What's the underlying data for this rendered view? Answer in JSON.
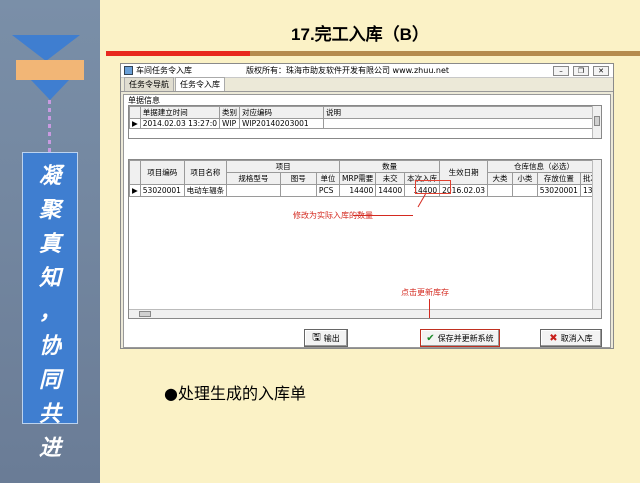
{
  "slide": {
    "title": "17.完工入库（B）",
    "motto_chars": [
      "凝",
      "聚",
      "真",
      "知",
      "，",
      "协",
      "同",
      "共",
      "进"
    ],
    "bullet": "●处理生成的入库单"
  },
  "window": {
    "title": "车间任务令入库",
    "copyright": "版权所有：珠海市助友软件开发有限公司 www.zhuu.net",
    "tabs": [
      "任务令导航",
      "任务令入库"
    ],
    "section_label": "单据信息",
    "header_grid": {
      "columns": [
        "单据建立时间",
        "类别",
        "对应编码",
        "说明"
      ],
      "row": [
        "2014.02.03 13:27:0",
        "WIP",
        "WIP20140203001",
        ""
      ]
    },
    "detail_grid": {
      "group_headers": {
        "item": "项目",
        "qty": "数量",
        "warehouse": "仓库信息（必选）"
      },
      "columns": [
        "项目编码",
        "项目名称",
        "规格型号",
        "图号",
        "单位",
        "MRP需要",
        "未交",
        "本次入库",
        "生效日期",
        "大类",
        "小类",
        "存放位置",
        "批次"
      ],
      "row": [
        "53020001",
        "电动车辐条",
        "",
        "",
        "PCS",
        "14400",
        "14400",
        "14400",
        "2016.02.03",
        "",
        "",
        "53020001",
        "13"
      ]
    },
    "annotations": {
      "modify_qty": "修改为实际入库的数量",
      "click_update": "点击更新库存"
    },
    "buttons": {
      "export": "输出",
      "save_update": "保存并更新系统",
      "cancel": "取消入库"
    }
  },
  "colors": {
    "accent_red": "#e8291e",
    "panel_blue": "#3f7ed0",
    "slide_bg": "#fbf2c6"
  }
}
